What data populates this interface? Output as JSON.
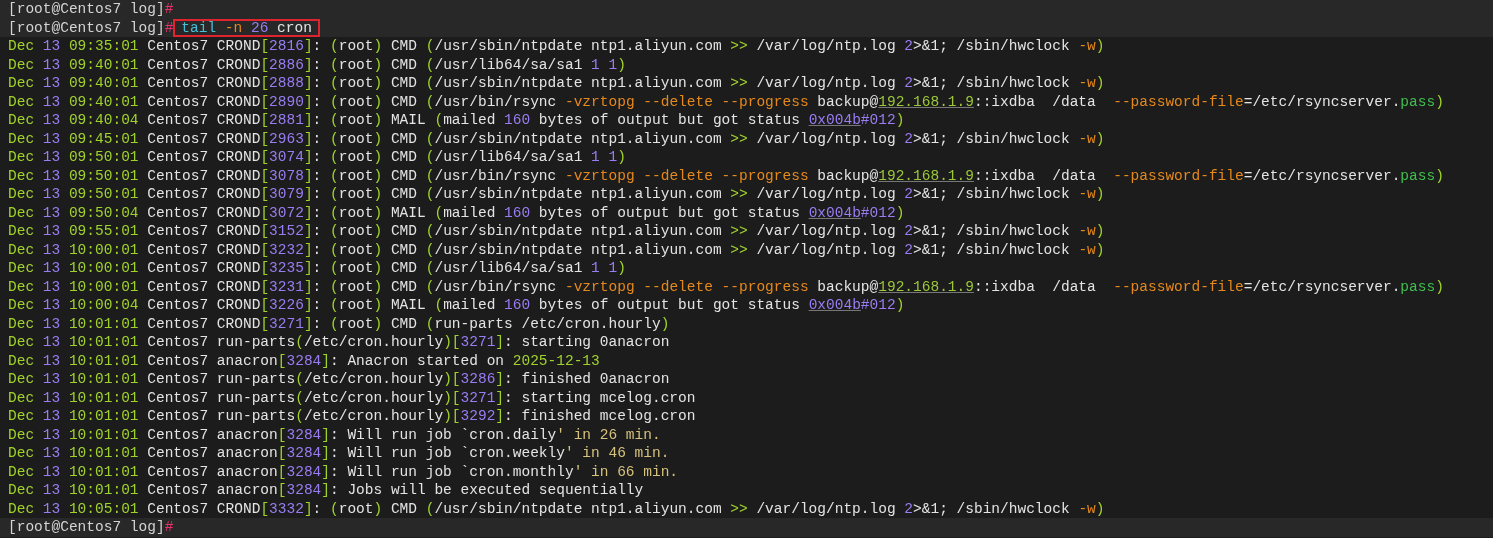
{
  "terminal": {
    "lines": [
      {
        "kind": "prompt",
        "prompt": [
          {
            "kind": "prompt",
            "text": "[root@Centos7 log]"
          },
          {
            "kind": "hash",
            "text": "#"
          }
        ]
      },
      {
        "kind": "prompt",
        "highlighted": true,
        "prompt": [
          {
            "kind": "prompt",
            "text": "[root@Centos7 log]"
          },
          {
            "kind": "hash",
            "text": "#"
          }
        ],
        "command": [
          {
            "kind": "cmd",
            "text": "tail "
          },
          {
            "kind": "flag",
            "text": "-n "
          },
          {
            "kind": "num",
            "text": "26"
          },
          {
            "kind": "plain",
            "text": " cron"
          }
        ]
      },
      {
        "kind": "output",
        "month": "Dec",
        "day": "13",
        "time": "09:35:01",
        "segments": [
          {
            "kind": "plain",
            "text": " Centos7 CROND"
          },
          {
            "kind": "punct",
            "text": "["
          },
          {
            "kind": "num",
            "text": "2816"
          },
          {
            "kind": "punct",
            "text": "]"
          },
          {
            "kind": "plain",
            "text": ": "
          },
          {
            "kind": "punct",
            "text": "("
          },
          {
            "kind": "plain",
            "text": "root"
          },
          {
            "kind": "punct",
            "text": ")"
          },
          {
            "kind": "plain",
            "text": " CMD "
          },
          {
            "kind": "punct",
            "text": "("
          },
          {
            "kind": "plain",
            "text": "/usr/sbin/ntpdate ntp1.aliyun.com "
          },
          {
            "kind": "punct",
            "text": ">>"
          },
          {
            "kind": "plain",
            "text": " /var/log/ntp.log "
          },
          {
            "kind": "num",
            "text": "2"
          },
          {
            "kind": "plain",
            "text": ">&1; /sbin/hwclock "
          },
          {
            "kind": "flag",
            "text": "-w"
          },
          {
            "kind": "punct",
            "text": ")"
          }
        ]
      },
      {
        "kind": "output",
        "month": "Dec",
        "day": "13",
        "time": "09:40:01",
        "segments": [
          {
            "kind": "plain",
            "text": " Centos7 CROND"
          },
          {
            "kind": "punct",
            "text": "["
          },
          {
            "kind": "num",
            "text": "2886"
          },
          {
            "kind": "punct",
            "text": "]"
          },
          {
            "kind": "plain",
            "text": ": "
          },
          {
            "kind": "punct",
            "text": "("
          },
          {
            "kind": "plain",
            "text": "root"
          },
          {
            "kind": "punct",
            "text": ")"
          },
          {
            "kind": "plain",
            "text": " CMD "
          },
          {
            "kind": "punct",
            "text": "("
          },
          {
            "kind": "plain",
            "text": "/usr/lib64/sa/sa1 "
          },
          {
            "kind": "num",
            "text": "1 1"
          },
          {
            "kind": "punct",
            "text": ")"
          }
        ]
      },
      {
        "kind": "output",
        "month": "Dec",
        "day": "13",
        "time": "09:40:01",
        "segments": [
          {
            "kind": "plain",
            "text": " Centos7 CROND"
          },
          {
            "kind": "punct",
            "text": "["
          },
          {
            "kind": "num",
            "text": "2888"
          },
          {
            "kind": "punct",
            "text": "]"
          },
          {
            "kind": "plain",
            "text": ": "
          },
          {
            "kind": "punct",
            "text": "("
          },
          {
            "kind": "plain",
            "text": "root"
          },
          {
            "kind": "punct",
            "text": ")"
          },
          {
            "kind": "plain",
            "text": " CMD "
          },
          {
            "kind": "punct",
            "text": "("
          },
          {
            "kind": "plain",
            "text": "/usr/sbin/ntpdate ntp1.aliyun.com "
          },
          {
            "kind": "punct",
            "text": ">>"
          },
          {
            "kind": "plain",
            "text": " /var/log/ntp.log "
          },
          {
            "kind": "num",
            "text": "2"
          },
          {
            "kind": "plain",
            "text": ">&1; /sbin/hwclock "
          },
          {
            "kind": "flag",
            "text": "-w"
          },
          {
            "kind": "punct",
            "text": ")"
          }
        ]
      },
      {
        "kind": "output",
        "month": "Dec",
        "day": "13",
        "time": "09:40:01",
        "segments": [
          {
            "kind": "plain",
            "text": " Centos7 CROND"
          },
          {
            "kind": "punct",
            "text": "["
          },
          {
            "kind": "num",
            "text": "2890"
          },
          {
            "kind": "punct",
            "text": "]"
          },
          {
            "kind": "plain",
            "text": ": "
          },
          {
            "kind": "punct",
            "text": "("
          },
          {
            "kind": "plain",
            "text": "root"
          },
          {
            "kind": "punct",
            "text": ")"
          },
          {
            "kind": "plain",
            "text": " CMD "
          },
          {
            "kind": "punct",
            "text": "("
          },
          {
            "kind": "plain",
            "text": "/usr/bin/rsync "
          },
          {
            "kind": "flag",
            "text": "-vzrtopg --delete --progress"
          },
          {
            "kind": "plain",
            "text": " backup@"
          },
          {
            "kind": "ip",
            "text": "192.168.1.9"
          },
          {
            "kind": "plain",
            "text": "::ixdba  /data  "
          },
          {
            "kind": "flag",
            "text": "--password-file"
          },
          {
            "kind": "plain",
            "text": "=/etc/rsyncserver."
          },
          {
            "kind": "string",
            "text": "pass"
          },
          {
            "kind": "punct",
            "text": ")"
          }
        ]
      },
      {
        "kind": "output",
        "month": "Dec",
        "day": "13",
        "time": "09:40:04",
        "segments": [
          {
            "kind": "plain",
            "text": " Centos7 CROND"
          },
          {
            "kind": "punct",
            "text": "["
          },
          {
            "kind": "num",
            "text": "2881"
          },
          {
            "kind": "punct",
            "text": "]"
          },
          {
            "kind": "plain",
            "text": ": "
          },
          {
            "kind": "punct",
            "text": "("
          },
          {
            "kind": "plain",
            "text": "root"
          },
          {
            "kind": "punct",
            "text": ")"
          },
          {
            "kind": "plain",
            "text": " MAIL "
          },
          {
            "kind": "punct",
            "text": "("
          },
          {
            "kind": "plain",
            "text": "mailed "
          },
          {
            "kind": "num",
            "text": "160"
          },
          {
            "kind": "plain",
            "text": " bytes of output but got status "
          },
          {
            "kind": "hex",
            "text": "0x004b"
          },
          {
            "kind": "num",
            "text": "#012"
          },
          {
            "kind": "punct",
            "text": ")"
          }
        ]
      },
      {
        "kind": "output",
        "month": "Dec",
        "day": "13",
        "time": "09:45:01",
        "segments": [
          {
            "kind": "plain",
            "text": " Centos7 CROND"
          },
          {
            "kind": "punct",
            "text": "["
          },
          {
            "kind": "num",
            "text": "2963"
          },
          {
            "kind": "punct",
            "text": "]"
          },
          {
            "kind": "plain",
            "text": ": "
          },
          {
            "kind": "punct",
            "text": "("
          },
          {
            "kind": "plain",
            "text": "root"
          },
          {
            "kind": "punct",
            "text": ")"
          },
          {
            "kind": "plain",
            "text": " CMD "
          },
          {
            "kind": "punct",
            "text": "("
          },
          {
            "kind": "plain",
            "text": "/usr/sbin/ntpdate ntp1.aliyun.com "
          },
          {
            "kind": "punct",
            "text": ">>"
          },
          {
            "kind": "plain",
            "text": " /var/log/ntp.log "
          },
          {
            "kind": "num",
            "text": "2"
          },
          {
            "kind": "plain",
            "text": ">&1; /sbin/hwclock "
          },
          {
            "kind": "flag",
            "text": "-w"
          },
          {
            "kind": "punct",
            "text": ")"
          }
        ]
      },
      {
        "kind": "output",
        "month": "Dec",
        "day": "13",
        "time": "09:50:01",
        "segments": [
          {
            "kind": "plain",
            "text": " Centos7 CROND"
          },
          {
            "kind": "punct",
            "text": "["
          },
          {
            "kind": "num",
            "text": "3074"
          },
          {
            "kind": "punct",
            "text": "]"
          },
          {
            "kind": "plain",
            "text": ": "
          },
          {
            "kind": "punct",
            "text": "("
          },
          {
            "kind": "plain",
            "text": "root"
          },
          {
            "kind": "punct",
            "text": ")"
          },
          {
            "kind": "plain",
            "text": " CMD "
          },
          {
            "kind": "punct",
            "text": "("
          },
          {
            "kind": "plain",
            "text": "/usr/lib64/sa/sa1 "
          },
          {
            "kind": "num",
            "text": "1 1"
          },
          {
            "kind": "punct",
            "text": ")"
          }
        ]
      },
      {
        "kind": "output",
        "month": "Dec",
        "day": "13",
        "time": "09:50:01",
        "segments": [
          {
            "kind": "plain",
            "text": " Centos7 CROND"
          },
          {
            "kind": "punct",
            "text": "["
          },
          {
            "kind": "num",
            "text": "3078"
          },
          {
            "kind": "punct",
            "text": "]"
          },
          {
            "kind": "plain",
            "text": ": "
          },
          {
            "kind": "punct",
            "text": "("
          },
          {
            "kind": "plain",
            "text": "root"
          },
          {
            "kind": "punct",
            "text": ")"
          },
          {
            "kind": "plain",
            "text": " CMD "
          },
          {
            "kind": "punct",
            "text": "("
          },
          {
            "kind": "plain",
            "text": "/usr/bin/rsync "
          },
          {
            "kind": "flag",
            "text": "-vzrtopg --delete --progress"
          },
          {
            "kind": "plain",
            "text": " backup@"
          },
          {
            "kind": "ip",
            "text": "192.168.1.9"
          },
          {
            "kind": "plain",
            "text": "::ixdba  /data  "
          },
          {
            "kind": "flag",
            "text": "--password-file"
          },
          {
            "kind": "plain",
            "text": "=/etc/rsyncserver."
          },
          {
            "kind": "string",
            "text": "pass"
          },
          {
            "kind": "punct",
            "text": ")"
          }
        ]
      },
      {
        "kind": "output",
        "month": "Dec",
        "day": "13",
        "time": "09:50:01",
        "segments": [
          {
            "kind": "plain",
            "text": " Centos7 CROND"
          },
          {
            "kind": "punct",
            "text": "["
          },
          {
            "kind": "num",
            "text": "3079"
          },
          {
            "kind": "punct",
            "text": "]"
          },
          {
            "kind": "plain",
            "text": ": "
          },
          {
            "kind": "punct",
            "text": "("
          },
          {
            "kind": "plain",
            "text": "root"
          },
          {
            "kind": "punct",
            "text": ")"
          },
          {
            "kind": "plain",
            "text": " CMD "
          },
          {
            "kind": "punct",
            "text": "("
          },
          {
            "kind": "plain",
            "text": "/usr/sbin/ntpdate ntp1.aliyun.com "
          },
          {
            "kind": "punct",
            "text": ">>"
          },
          {
            "kind": "plain",
            "text": " /var/log/ntp.log "
          },
          {
            "kind": "num",
            "text": "2"
          },
          {
            "kind": "plain",
            "text": ">&1; /sbin/hwclock "
          },
          {
            "kind": "flag",
            "text": "-w"
          },
          {
            "kind": "punct",
            "text": ")"
          }
        ]
      },
      {
        "kind": "output",
        "month": "Dec",
        "day": "13",
        "time": "09:50:04",
        "segments": [
          {
            "kind": "plain",
            "text": " Centos7 CROND"
          },
          {
            "kind": "punct",
            "text": "["
          },
          {
            "kind": "num",
            "text": "3072"
          },
          {
            "kind": "punct",
            "text": "]"
          },
          {
            "kind": "plain",
            "text": ": "
          },
          {
            "kind": "punct",
            "text": "("
          },
          {
            "kind": "plain",
            "text": "root"
          },
          {
            "kind": "punct",
            "text": ")"
          },
          {
            "kind": "plain",
            "text": " MAIL "
          },
          {
            "kind": "punct",
            "text": "("
          },
          {
            "kind": "plain",
            "text": "mailed "
          },
          {
            "kind": "num",
            "text": "160"
          },
          {
            "kind": "plain",
            "text": " bytes of output but got status "
          },
          {
            "kind": "hex",
            "text": "0x004b"
          },
          {
            "kind": "num",
            "text": "#012"
          },
          {
            "kind": "punct",
            "text": ")"
          }
        ]
      },
      {
        "kind": "output",
        "month": "Dec",
        "day": "13",
        "time": "09:55:01",
        "segments": [
          {
            "kind": "plain",
            "text": " Centos7 CROND"
          },
          {
            "kind": "punct",
            "text": "["
          },
          {
            "kind": "num",
            "text": "3152"
          },
          {
            "kind": "punct",
            "text": "]"
          },
          {
            "kind": "plain",
            "text": ": "
          },
          {
            "kind": "punct",
            "text": "("
          },
          {
            "kind": "plain",
            "text": "root"
          },
          {
            "kind": "punct",
            "text": ")"
          },
          {
            "kind": "plain",
            "text": " CMD "
          },
          {
            "kind": "punct",
            "text": "("
          },
          {
            "kind": "plain",
            "text": "/usr/sbin/ntpdate ntp1.aliyun.com "
          },
          {
            "kind": "punct",
            "text": ">>"
          },
          {
            "kind": "plain",
            "text": " /var/log/ntp.log "
          },
          {
            "kind": "num",
            "text": "2"
          },
          {
            "kind": "plain",
            "text": ">&1; /sbin/hwclock "
          },
          {
            "kind": "flag",
            "text": "-w"
          },
          {
            "kind": "punct",
            "text": ")"
          }
        ]
      },
      {
        "kind": "output",
        "month": "Dec",
        "day": "13",
        "time": "10:00:01",
        "segments": [
          {
            "kind": "plain",
            "text": " Centos7 CROND"
          },
          {
            "kind": "punct",
            "text": "["
          },
          {
            "kind": "num",
            "text": "3232"
          },
          {
            "kind": "punct",
            "text": "]"
          },
          {
            "kind": "plain",
            "text": ": "
          },
          {
            "kind": "punct",
            "text": "("
          },
          {
            "kind": "plain",
            "text": "root"
          },
          {
            "kind": "punct",
            "text": ")"
          },
          {
            "kind": "plain",
            "text": " CMD "
          },
          {
            "kind": "punct",
            "text": "("
          },
          {
            "kind": "plain",
            "text": "/usr/sbin/ntpdate ntp1.aliyun.com "
          },
          {
            "kind": "punct",
            "text": ">>"
          },
          {
            "kind": "plain",
            "text": " /var/log/ntp.log "
          },
          {
            "kind": "num",
            "text": "2"
          },
          {
            "kind": "plain",
            "text": ">&1; /sbin/hwclock "
          },
          {
            "kind": "flag",
            "text": "-w"
          },
          {
            "kind": "punct",
            "text": ")"
          }
        ]
      },
      {
        "kind": "output",
        "month": "Dec",
        "day": "13",
        "time": "10:00:01",
        "segments": [
          {
            "kind": "plain",
            "text": " Centos7 CROND"
          },
          {
            "kind": "punct",
            "text": "["
          },
          {
            "kind": "num",
            "text": "3235"
          },
          {
            "kind": "punct",
            "text": "]"
          },
          {
            "kind": "plain",
            "text": ": "
          },
          {
            "kind": "punct",
            "text": "("
          },
          {
            "kind": "plain",
            "text": "root"
          },
          {
            "kind": "punct",
            "text": ")"
          },
          {
            "kind": "plain",
            "text": " CMD "
          },
          {
            "kind": "punct",
            "text": "("
          },
          {
            "kind": "plain",
            "text": "/usr/lib64/sa/sa1 "
          },
          {
            "kind": "num",
            "text": "1 1"
          },
          {
            "kind": "punct",
            "text": ")"
          }
        ]
      },
      {
        "kind": "output",
        "month": "Dec",
        "day": "13",
        "time": "10:00:01",
        "segments": [
          {
            "kind": "plain",
            "text": " Centos7 CROND"
          },
          {
            "kind": "punct",
            "text": "["
          },
          {
            "kind": "num",
            "text": "3231"
          },
          {
            "kind": "punct",
            "text": "]"
          },
          {
            "kind": "plain",
            "text": ": "
          },
          {
            "kind": "punct",
            "text": "("
          },
          {
            "kind": "plain",
            "text": "root"
          },
          {
            "kind": "punct",
            "text": ")"
          },
          {
            "kind": "plain",
            "text": " CMD "
          },
          {
            "kind": "punct",
            "text": "("
          },
          {
            "kind": "plain",
            "text": "/usr/bin/rsync "
          },
          {
            "kind": "flag",
            "text": "-vzrtopg --delete --progress"
          },
          {
            "kind": "plain",
            "text": " backup@"
          },
          {
            "kind": "ip",
            "text": "192.168.1.9"
          },
          {
            "kind": "plain",
            "text": "::ixdba  /data  "
          },
          {
            "kind": "flag",
            "text": "--password-file"
          },
          {
            "kind": "plain",
            "text": "=/etc/rsyncserver."
          },
          {
            "kind": "string",
            "text": "pass"
          },
          {
            "kind": "punct",
            "text": ")"
          }
        ]
      },
      {
        "kind": "output",
        "month": "Dec",
        "day": "13",
        "time": "10:00:04",
        "segments": [
          {
            "kind": "plain",
            "text": " Centos7 CROND"
          },
          {
            "kind": "punct",
            "text": "["
          },
          {
            "kind": "num",
            "text": "3226"
          },
          {
            "kind": "punct",
            "text": "]"
          },
          {
            "kind": "plain",
            "text": ": "
          },
          {
            "kind": "punct",
            "text": "("
          },
          {
            "kind": "plain",
            "text": "root"
          },
          {
            "kind": "punct",
            "text": ")"
          },
          {
            "kind": "plain",
            "text": " MAIL "
          },
          {
            "kind": "punct",
            "text": "("
          },
          {
            "kind": "plain",
            "text": "mailed "
          },
          {
            "kind": "num",
            "text": "160"
          },
          {
            "kind": "plain",
            "text": " bytes of output but got status "
          },
          {
            "kind": "hex",
            "text": "0x004b"
          },
          {
            "kind": "num",
            "text": "#012"
          },
          {
            "kind": "punct",
            "text": ")"
          }
        ]
      },
      {
        "kind": "output",
        "month": "Dec",
        "day": "13",
        "time": "10:01:01",
        "segments": [
          {
            "kind": "plain",
            "text": " Centos7 CROND"
          },
          {
            "kind": "punct",
            "text": "["
          },
          {
            "kind": "num",
            "text": "3271"
          },
          {
            "kind": "punct",
            "text": "]"
          },
          {
            "kind": "plain",
            "text": ": "
          },
          {
            "kind": "punct",
            "text": "("
          },
          {
            "kind": "plain",
            "text": "root"
          },
          {
            "kind": "punct",
            "text": ")"
          },
          {
            "kind": "plain",
            "text": " CMD "
          },
          {
            "kind": "punct",
            "text": "("
          },
          {
            "kind": "plain",
            "text": "run-parts /etc/cron.hourly"
          },
          {
            "kind": "punct",
            "text": ")"
          }
        ]
      },
      {
        "kind": "output",
        "month": "Dec",
        "day": "13",
        "time": "10:01:01",
        "segments": [
          {
            "kind": "plain",
            "text": " Centos7 run-parts"
          },
          {
            "kind": "punct",
            "text": "("
          },
          {
            "kind": "plain",
            "text": "/etc/cron.hourly"
          },
          {
            "kind": "punct",
            "text": ")["
          },
          {
            "kind": "num",
            "text": "3271"
          },
          {
            "kind": "punct",
            "text": "]"
          },
          {
            "kind": "plain",
            "text": ": starting 0anacron"
          }
        ]
      },
      {
        "kind": "output",
        "month": "Dec",
        "day": "13",
        "time": "10:01:01",
        "segments": [
          {
            "kind": "plain",
            "text": " Centos7 anacron"
          },
          {
            "kind": "punct",
            "text": "["
          },
          {
            "kind": "num",
            "text": "3284"
          },
          {
            "kind": "punct",
            "text": "]"
          },
          {
            "kind": "plain",
            "text": ": Anacron started on "
          },
          {
            "kind": "date",
            "text": "2025-12-13"
          }
        ]
      },
      {
        "kind": "output",
        "month": "Dec",
        "day": "13",
        "time": "10:01:01",
        "segments": [
          {
            "kind": "plain",
            "text": " Centos7 run-parts"
          },
          {
            "kind": "punct",
            "text": "("
          },
          {
            "kind": "plain",
            "text": "/etc/cron.hourly"
          },
          {
            "kind": "punct",
            "text": ")["
          },
          {
            "kind": "num",
            "text": "3286"
          },
          {
            "kind": "punct",
            "text": "]"
          },
          {
            "kind": "plain",
            "text": ": finished 0anacron"
          }
        ]
      },
      {
        "kind": "output",
        "month": "Dec",
        "day": "13",
        "time": "10:01:01",
        "segments": [
          {
            "kind": "plain",
            "text": " Centos7 run-parts"
          },
          {
            "kind": "punct",
            "text": "("
          },
          {
            "kind": "plain",
            "text": "/etc/cron.hourly"
          },
          {
            "kind": "punct",
            "text": ")["
          },
          {
            "kind": "num",
            "text": "3271"
          },
          {
            "kind": "punct",
            "text": "]"
          },
          {
            "kind": "plain",
            "text": ": starting mcelog.cron"
          }
        ]
      },
      {
        "kind": "output",
        "month": "Dec",
        "day": "13",
        "time": "10:01:01",
        "segments": [
          {
            "kind": "plain",
            "text": " Centos7 run-parts"
          },
          {
            "kind": "punct",
            "text": "("
          },
          {
            "kind": "plain",
            "text": "/etc/cron.hourly"
          },
          {
            "kind": "punct",
            "text": ")["
          },
          {
            "kind": "num",
            "text": "3292"
          },
          {
            "kind": "punct",
            "text": "]"
          },
          {
            "kind": "plain",
            "text": ": finished mcelog.cron"
          }
        ]
      },
      {
        "kind": "output",
        "month": "Dec",
        "day": "13",
        "time": "10:01:01",
        "segments": [
          {
            "kind": "plain",
            "text": " Centos7 anacron"
          },
          {
            "kind": "punct",
            "text": "["
          },
          {
            "kind": "num",
            "text": "3284"
          },
          {
            "kind": "punct",
            "text": "]"
          },
          {
            "kind": "plain",
            "text": ": Will run job `cron.daily"
          },
          {
            "kind": "quote",
            "text": "' in 26 min."
          }
        ]
      },
      {
        "kind": "output",
        "month": "Dec",
        "day": "13",
        "time": "10:01:01",
        "segments": [
          {
            "kind": "plain",
            "text": " Centos7 anacron"
          },
          {
            "kind": "punct",
            "text": "["
          },
          {
            "kind": "num",
            "text": "3284"
          },
          {
            "kind": "punct",
            "text": "]"
          },
          {
            "kind": "plain",
            "text": ": Will run job `cron.weekly"
          },
          {
            "kind": "quote",
            "text": "' in 46 min."
          }
        ]
      },
      {
        "kind": "output",
        "month": "Dec",
        "day": "13",
        "time": "10:01:01",
        "segments": [
          {
            "kind": "plain",
            "text": " Centos7 anacron"
          },
          {
            "kind": "punct",
            "text": "["
          },
          {
            "kind": "num",
            "text": "3284"
          },
          {
            "kind": "punct",
            "text": "]"
          },
          {
            "kind": "plain",
            "text": ": Will run job `cron.monthly"
          },
          {
            "kind": "quote",
            "text": "' in 66 min."
          }
        ]
      },
      {
        "kind": "output",
        "month": "Dec",
        "day": "13",
        "time": "10:01:01",
        "segments": [
          {
            "kind": "plain",
            "text": " Centos7 anacron"
          },
          {
            "kind": "punct",
            "text": "["
          },
          {
            "kind": "num",
            "text": "3284"
          },
          {
            "kind": "punct",
            "text": "]"
          },
          {
            "kind": "plain",
            "text": ": Jobs will be executed sequentially"
          }
        ]
      },
      {
        "kind": "output",
        "month": "Dec",
        "day": "13",
        "time": "10:05:01",
        "segments": [
          {
            "kind": "plain",
            "text": " Centos7 CROND"
          },
          {
            "kind": "punct",
            "text": "["
          },
          {
            "kind": "num",
            "text": "3332"
          },
          {
            "kind": "punct",
            "text": "]"
          },
          {
            "kind": "plain",
            "text": ": "
          },
          {
            "kind": "punct",
            "text": "("
          },
          {
            "kind": "plain",
            "text": "root"
          },
          {
            "kind": "punct",
            "text": ")"
          },
          {
            "kind": "plain",
            "text": " CMD "
          },
          {
            "kind": "punct",
            "text": "("
          },
          {
            "kind": "plain",
            "text": "/usr/sbin/ntpdate ntp1.aliyun.com "
          },
          {
            "kind": "punct",
            "text": ">>"
          },
          {
            "kind": "plain",
            "text": " /var/log/ntp.log "
          },
          {
            "kind": "num",
            "text": "2"
          },
          {
            "kind": "plain",
            "text": ">&1; /sbin/hwclock "
          },
          {
            "kind": "flag",
            "text": "-w"
          },
          {
            "kind": "punct",
            "text": ")"
          }
        ]
      },
      {
        "kind": "prompt",
        "prompt": [
          {
            "kind": "prompt",
            "text": "[root@Centos7 log]"
          },
          {
            "kind": "hash",
            "text": "#"
          }
        ]
      }
    ]
  }
}
